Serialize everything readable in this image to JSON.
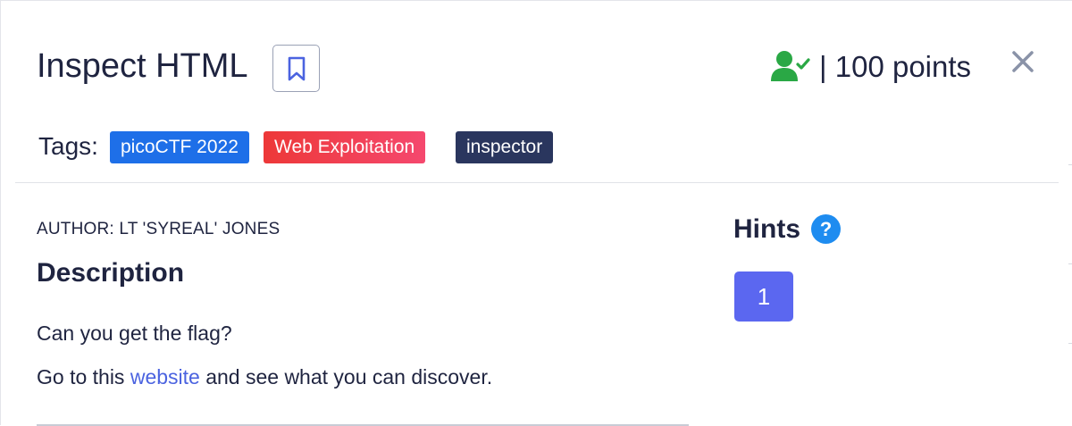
{
  "challenge": {
    "title": "Inspect HTML",
    "points_label": "| 100 points"
  },
  "tags": {
    "label": "Tags:",
    "items": [
      "picoCTF 2022",
      "Web Exploitation",
      "inspector"
    ]
  },
  "author": "AUTHOR: LT 'SYREAL' JONES",
  "description": {
    "heading": "Description",
    "line1": "Can you get the flag?",
    "line2_prefix": "Go to this ",
    "link_text": "website",
    "line2_suffix": " and see what you can discover."
  },
  "hints": {
    "heading": "Hints",
    "help_symbol": "?",
    "items": [
      "1"
    ]
  },
  "icons": {
    "bookmark": "bookmark-icon",
    "solved": "user-check-icon",
    "close": "close-icon"
  },
  "colors": {
    "tag_pico": "#1e6fe8",
    "tag_web": "#ed3838",
    "tag_inspector": "#2a365e",
    "solved_green": "#2aa845",
    "hint_button": "#5b67f0",
    "link": "#4b63e0"
  }
}
